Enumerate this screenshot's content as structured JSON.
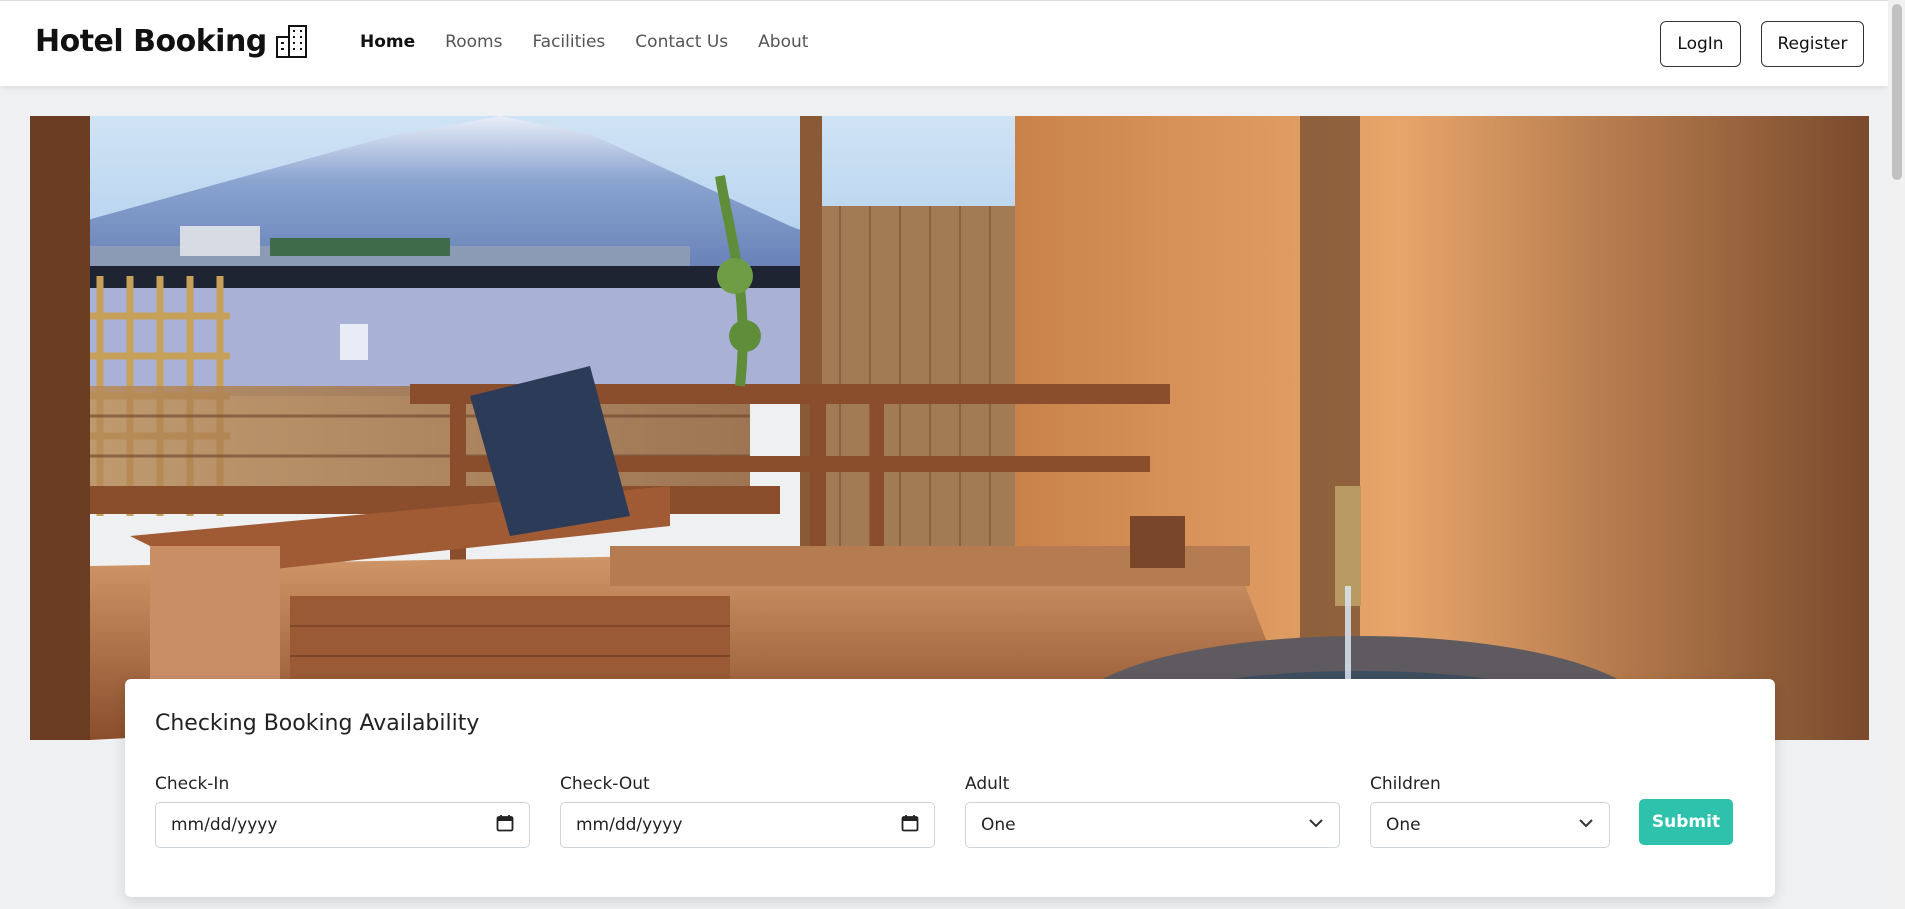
{
  "brand": {
    "title": "Hotel Booking",
    "icon": "building-icon"
  },
  "nav": {
    "links": [
      {
        "label": "Home",
        "active": true
      },
      {
        "label": "Rooms",
        "active": false
      },
      {
        "label": "Facilities",
        "active": false
      },
      {
        "label": "Contact Us",
        "active": false
      },
      {
        "label": "About",
        "active": false
      }
    ],
    "login_label": "LogIn",
    "register_label": "Register"
  },
  "booking": {
    "title": "Checking Booking Availability",
    "checkin": {
      "label": "Check-In",
      "value": "mm/dd/yyyy"
    },
    "checkout": {
      "label": "Check-Out",
      "value": "mm/dd/yyyy"
    },
    "adult": {
      "label": "Adult",
      "value": "One"
    },
    "children": {
      "label": "Children",
      "value": "One"
    },
    "submit_label": "Submit"
  },
  "colors": {
    "accent": "#2ec1ac"
  }
}
